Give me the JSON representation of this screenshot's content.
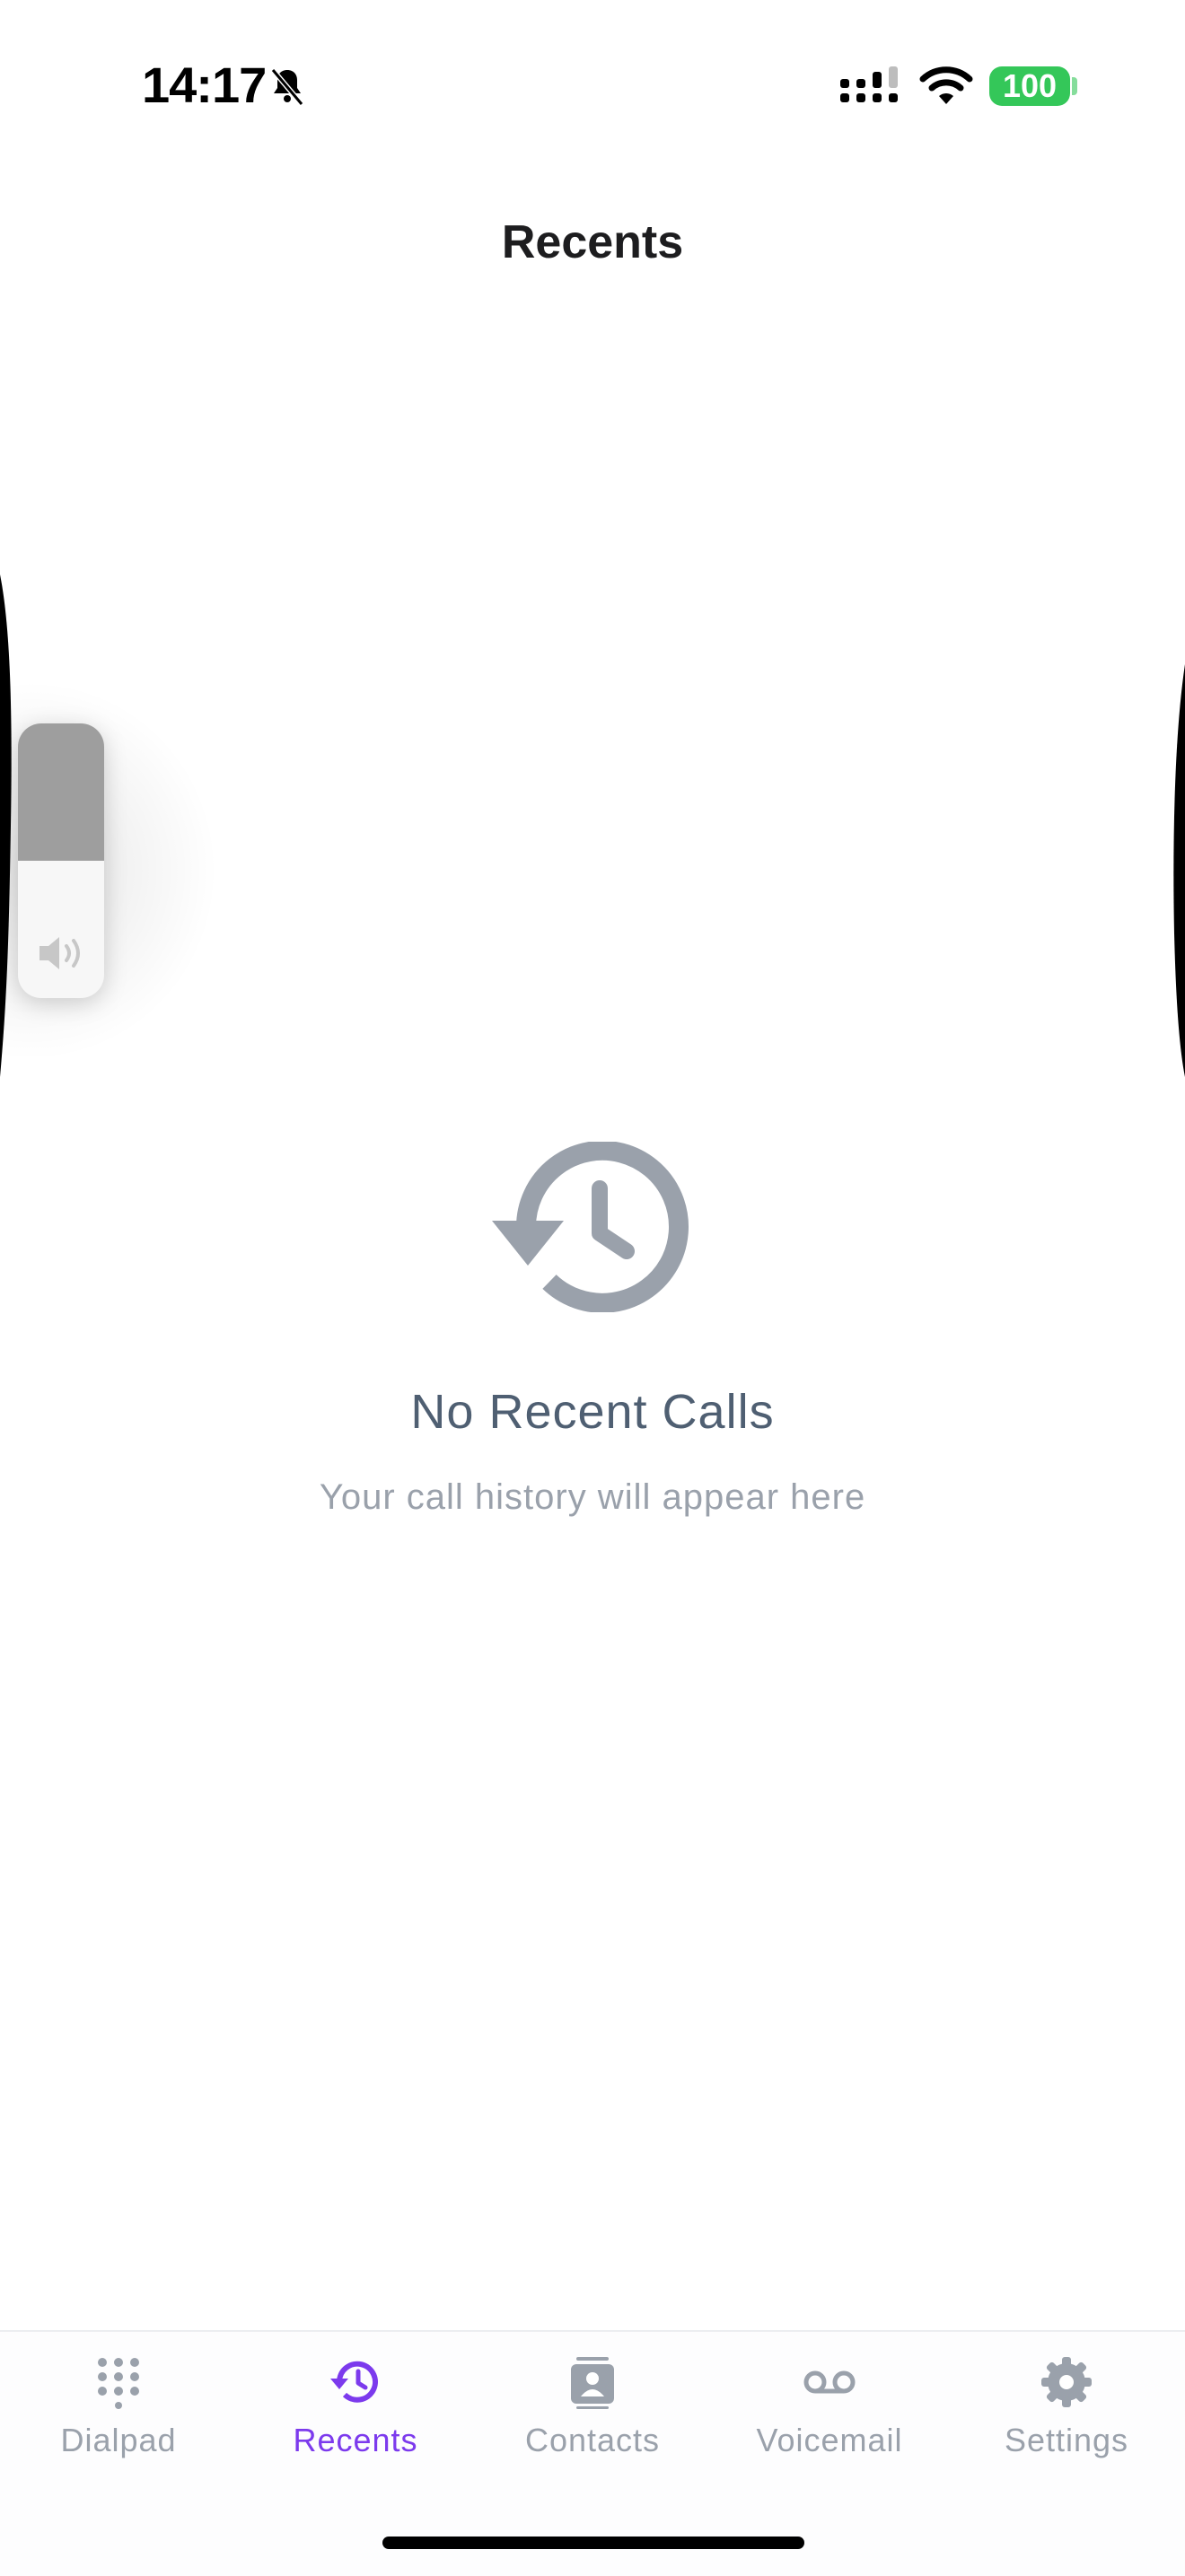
{
  "status_bar": {
    "time": "14:17",
    "battery": "100",
    "icons": [
      "bell-slash-icon",
      "cellular-signal-icon",
      "wifi-icon",
      "battery-icon"
    ],
    "battery_color": "#34c759"
  },
  "header": {
    "title": "Recents"
  },
  "volume_hud": {
    "level": 0.5,
    "icon": "speaker-icon"
  },
  "empty_state": {
    "icon": "history-icon",
    "title": "No Recent Calls",
    "subtitle": "Your call history will appear here"
  },
  "tab_bar": {
    "active_color": "#7c3aed",
    "inactive_color": "#9aa1ab",
    "tabs": [
      {
        "label": "Dialpad",
        "icon": "dialpad-icon",
        "active": false
      },
      {
        "label": "Recents",
        "icon": "history-icon",
        "active": true
      },
      {
        "label": "Contacts",
        "icon": "contacts-icon",
        "active": false
      },
      {
        "label": "Voicemail",
        "icon": "voicemail-icon",
        "active": false
      },
      {
        "label": "Settings",
        "icon": "gear-icon",
        "active": false
      }
    ]
  }
}
